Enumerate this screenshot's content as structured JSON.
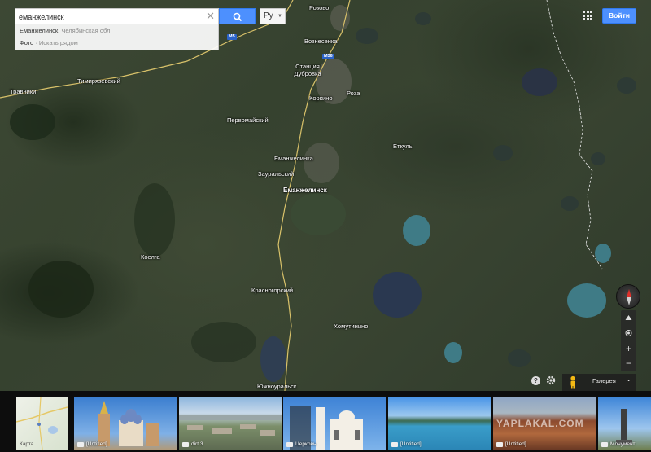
{
  "search": {
    "value": "еманжелинск",
    "suggestions": [
      {
        "bold": "Еманжелинск",
        "rest": ", Челябинская обл."
      },
      {
        "bold": "Фото",
        "rest": " · Искать рядом"
      }
    ],
    "lang": "Ру"
  },
  "header": {
    "signin_label": "Войти"
  },
  "map": {
    "places": [
      {
        "name": "Еманжелинск",
        "major": true
      },
      {
        "name": "Еманжелинка"
      },
      {
        "name": "Зауральский"
      },
      {
        "name": "Первомайский"
      },
      {
        "name": "Коркино"
      },
      {
        "name": "Роза"
      },
      {
        "name": "Станция Дубровка"
      },
      {
        "name": "Вознесенка"
      },
      {
        "name": "Тимирязевский"
      },
      {
        "name": "Травники"
      },
      {
        "name": "Еткуль"
      },
      {
        "name": "Коелга"
      },
      {
        "name": "Красногорский"
      },
      {
        "name": "Хомутинино"
      },
      {
        "name": "Южноуральск"
      },
      {
        "name": "Розово"
      }
    ],
    "roads": [
      "M5",
      "M36"
    ]
  },
  "controls": {
    "zoom_in": "+",
    "zoom_out": "−",
    "help": "?",
    "gallery_label": "Галерея"
  },
  "strip": {
    "cards": [
      {
        "caption": "Карта"
      },
      {
        "caption": "[Untitled]"
      },
      {
        "caption": "dirt 3"
      },
      {
        "caption": "Церковь"
      },
      {
        "caption": "[Untitled]"
      },
      {
        "caption": "[Untitled]"
      },
      {
        "caption": "Монумент"
      }
    ],
    "watermark": "YAPLAKAL.COM"
  },
  "colors": {
    "accent": "#4d90fe",
    "road": "#d9c26a",
    "water": "#2e3c52"
  }
}
